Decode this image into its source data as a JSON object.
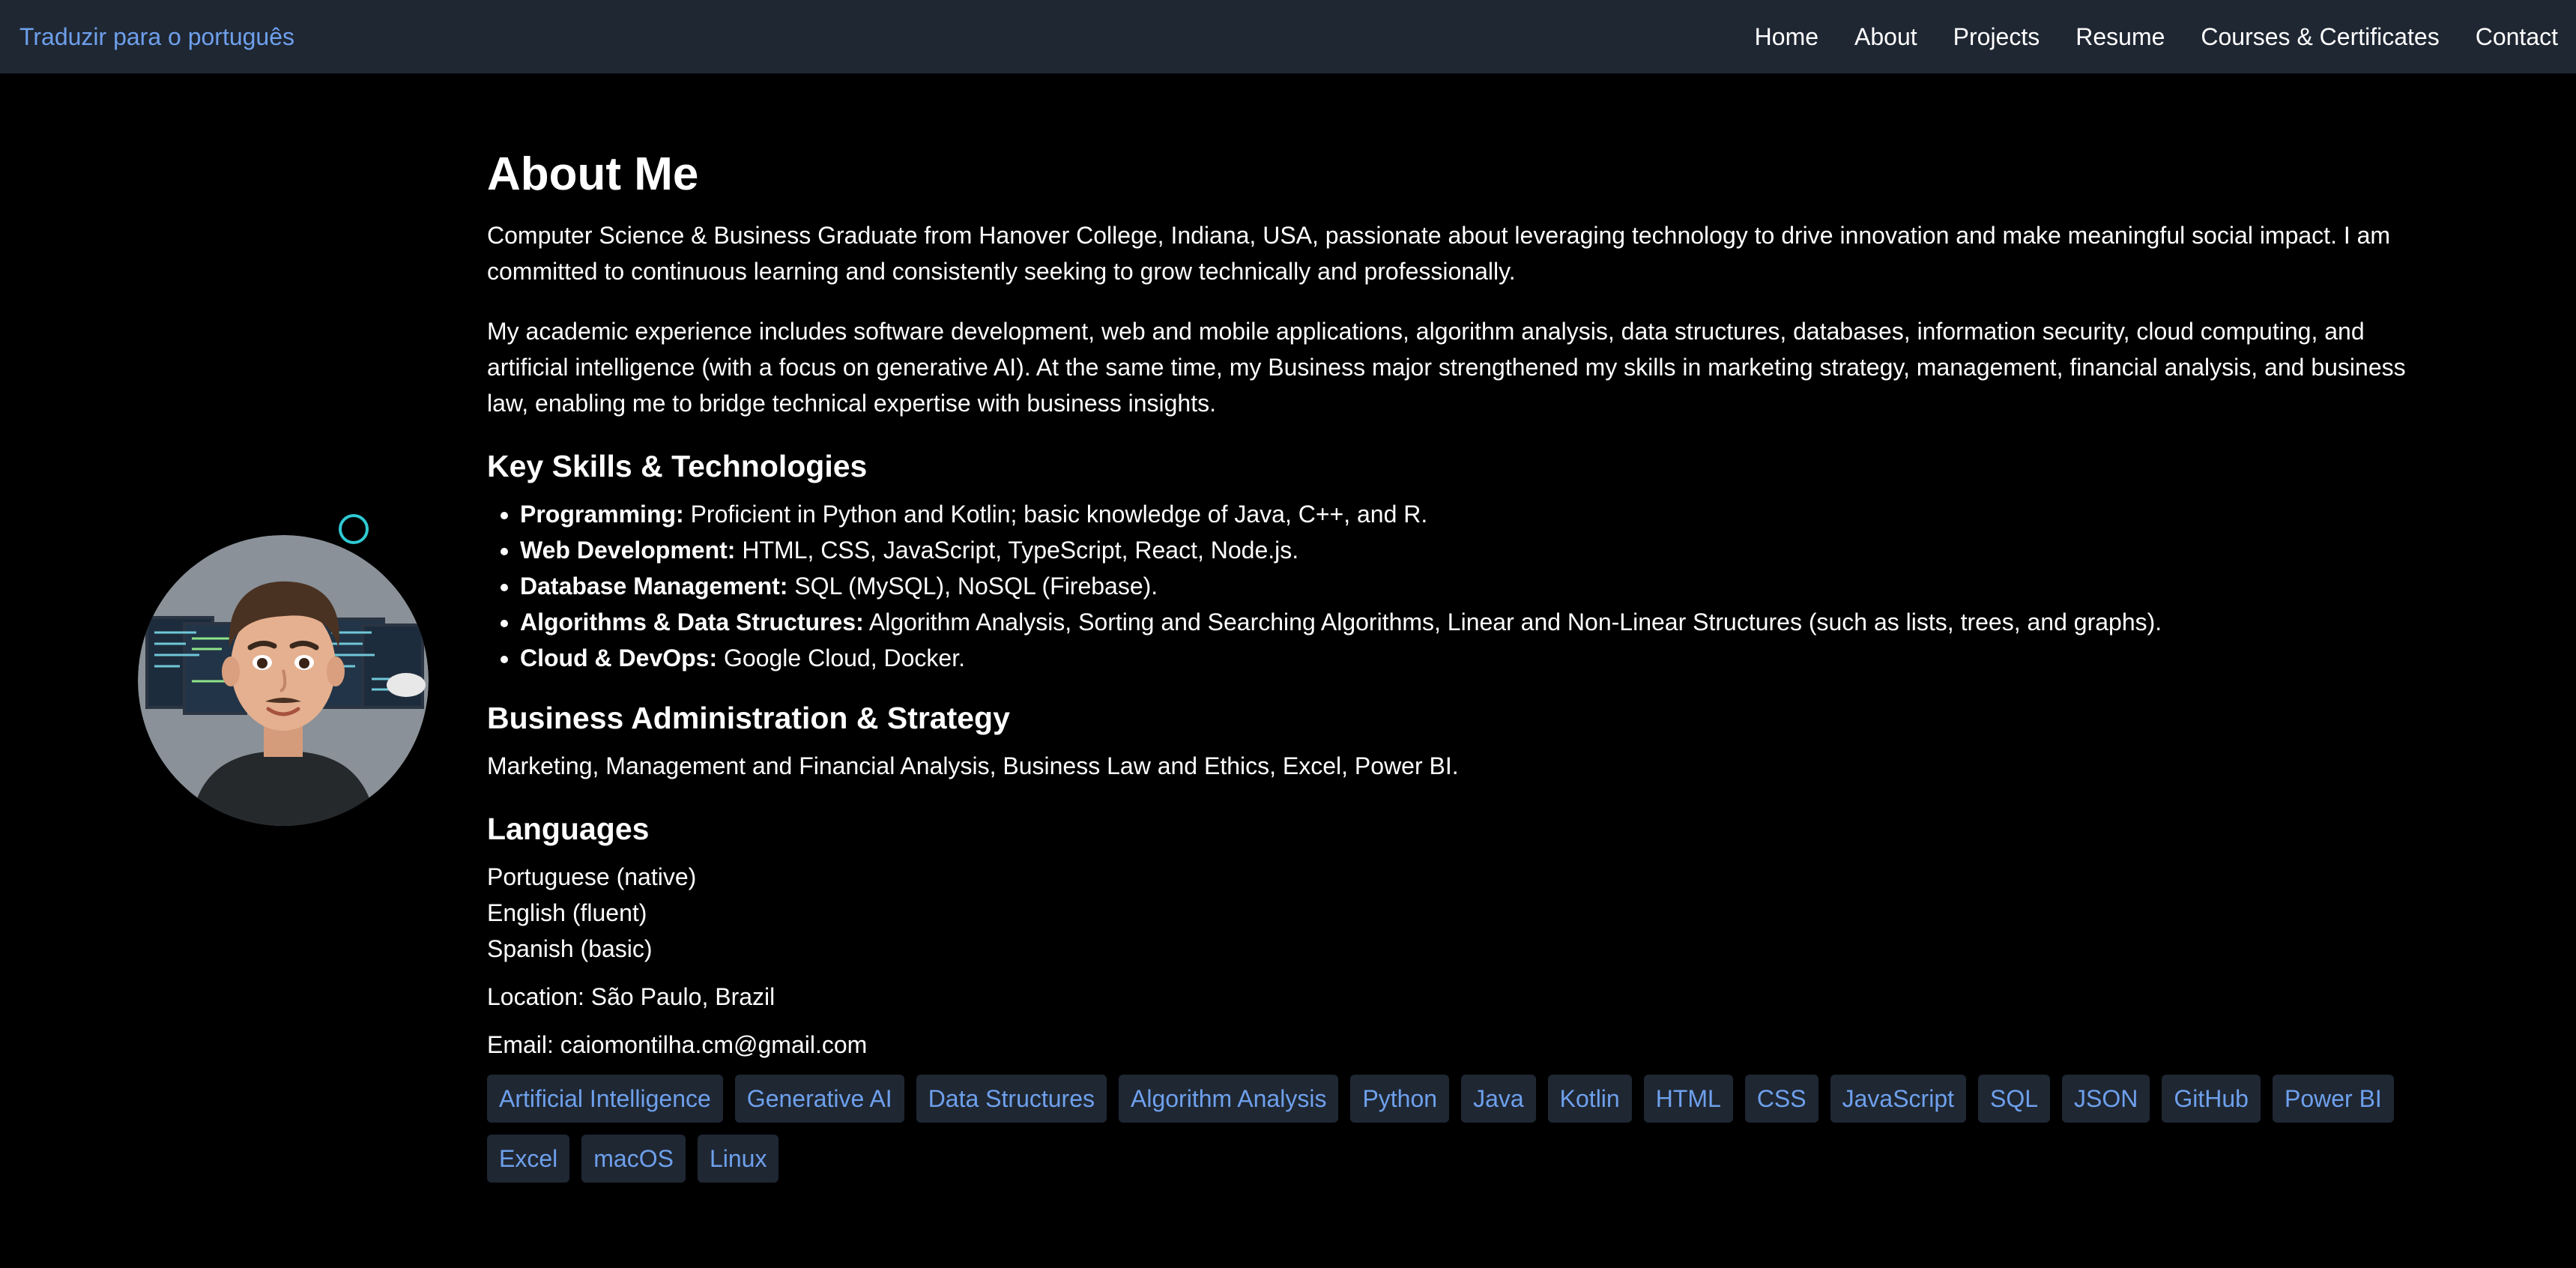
{
  "navbar": {
    "translate_link": "Traduzir para o português",
    "links": [
      "Home",
      "About",
      "Projects",
      "Resume",
      "Courses & Certificates",
      "Contact"
    ]
  },
  "about": {
    "title": "About Me",
    "intro": "Computer Science & Business Graduate from Hanover College, Indiana, USA, passionate about leveraging technology to drive innovation and make meaningful social impact. I am committed to continuous learning and consistently seeking to grow technically and professionally.",
    "academic": "My academic experience includes software development, web and mobile applications, algorithm analysis, data structures, databases, information security, cloud computing, and artificial intelligence (with a focus on generative AI). At the same time, my Business major strengthened my skills in marketing strategy, management, financial analysis, and business law, enabling me to bridge technical expertise with business insights."
  },
  "skills": {
    "title": "Key Skills & Technologies",
    "items": [
      {
        "label": "Programming:",
        "text": " Proficient in Python and Kotlin; basic knowledge of Java, C++, and R."
      },
      {
        "label": "Web Development:",
        "text": " HTML, CSS, JavaScript, TypeScript, React, Node.js."
      },
      {
        "label": "Database Management:",
        "text": " SQL (MySQL), NoSQL (Firebase)."
      },
      {
        "label": "Algorithms & Data Structures:",
        "text": " Algorithm Analysis, Sorting and Searching Algorithms, Linear and Non-Linear Structures (such as lists, trees, and graphs)."
      },
      {
        "label": "Cloud & DevOps:",
        "text": " Google Cloud, Docker."
      }
    ]
  },
  "business": {
    "title": "Business Administration & Strategy",
    "text": "Marketing, Management and Financial Analysis, Business Law and Ethics, Excel, Power BI."
  },
  "languages": {
    "title": "Languages",
    "items": [
      "Portuguese (native)",
      "English (fluent)",
      "Spanish (basic)"
    ]
  },
  "location": "Location: São Paulo, Brazil",
  "email": "Email: caiomontilha.cm@gmail.com",
  "tags": [
    "Artificial Intelligence",
    "Generative AI",
    "Data Structures",
    "Algorithm Analysis",
    "Python",
    "Java",
    "Kotlin",
    "HTML",
    "CSS",
    "JavaScript",
    "SQL",
    "JSON",
    "GitHub",
    "Power BI",
    "Excel",
    "macOS",
    "Linux"
  ],
  "colors": {
    "navbar_bg": "#1f2733",
    "accent_link": "#6ea0ec",
    "status_ring": "#2fc9d2",
    "page_bg": "#000000"
  },
  "icons": {
    "avatar": "profile-avatar",
    "status": "status-ring-icon"
  }
}
